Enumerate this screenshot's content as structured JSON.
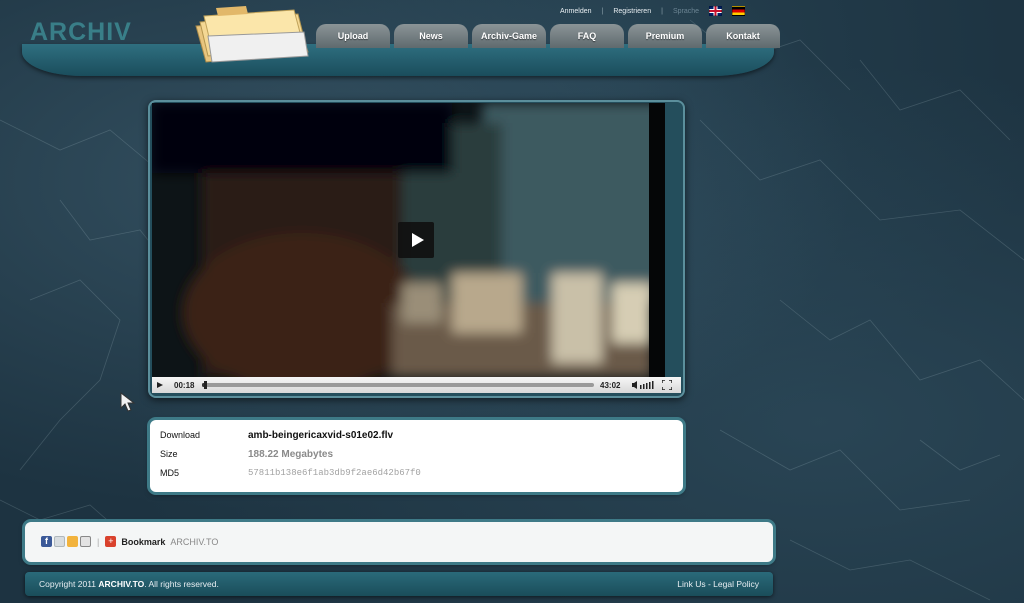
{
  "header": {
    "logo_text": "ARCHIV",
    "top_links": {
      "login": "Anmelden",
      "register": "Registrieren",
      "language_label": "Sprache"
    },
    "nav": [
      "Upload",
      "News",
      "Archiv-Game",
      "FAQ",
      "Premium",
      "Kontakt"
    ]
  },
  "player": {
    "current_time": "00:18",
    "duration": "43:02",
    "progress_fraction": 0.007
  },
  "file": {
    "download_label": "Download",
    "name": "amb-beingericaxvid-s01e02.flv",
    "size_label": "Size",
    "size": "188.22 Megabytes",
    "md5_label": "MD5",
    "md5": "57811b138e6f1ab3db9f2ae6d42b67f0"
  },
  "share": {
    "bookmark_label": "Bookmark",
    "site": "ARCHIV.TO"
  },
  "footer": {
    "copyright_prefix": "Copyright 2011",
    "brand": "ARCHIV.TO",
    "copyright_suffix": ". All rights reserved.",
    "link_us": "Link Us",
    "separator": " - ",
    "legal": "Legal Policy"
  },
  "colors": {
    "background": "#1d3341",
    "header_teal": "#2f6f80",
    "nav_tab": "#7d878a",
    "panel_border": "#3e7a87"
  }
}
